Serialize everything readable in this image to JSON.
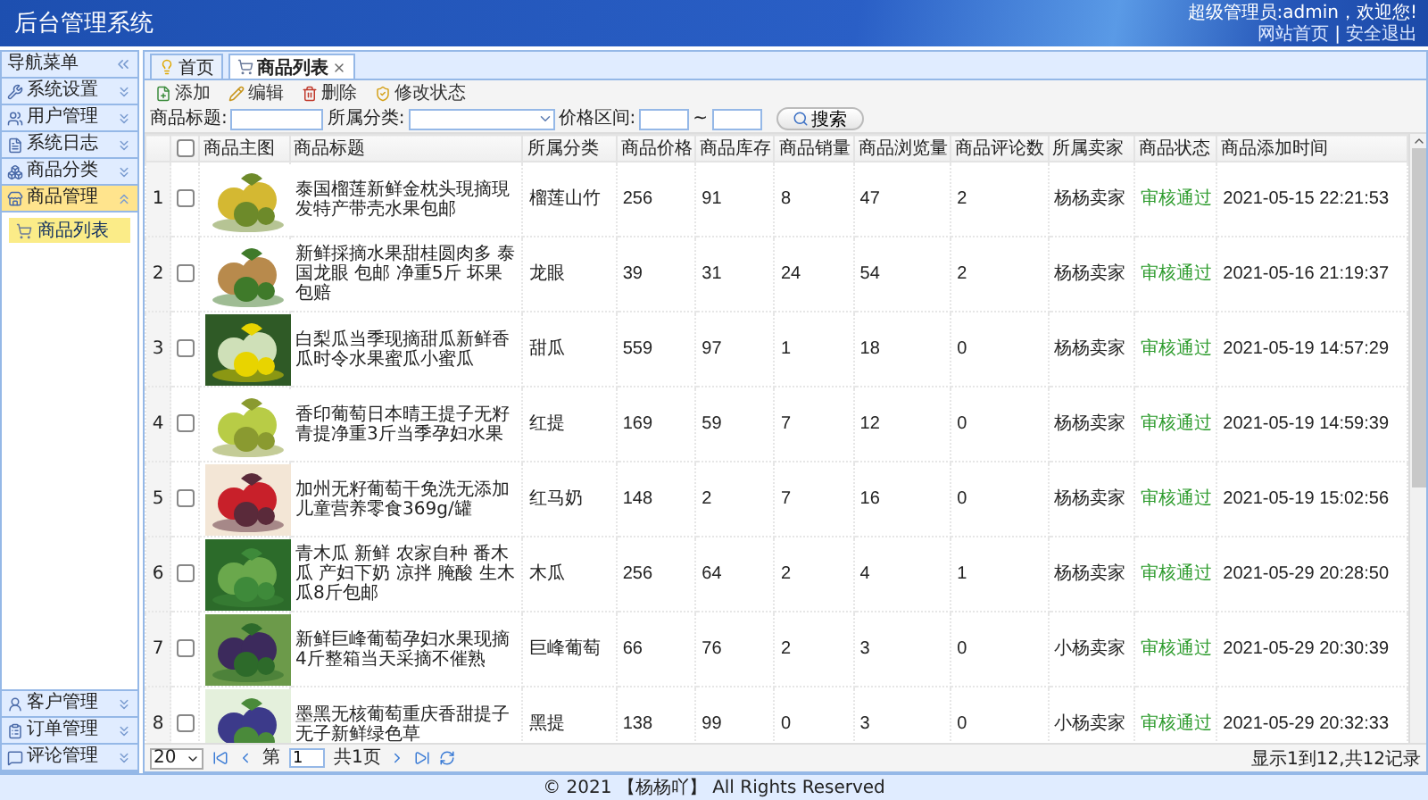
{
  "header": {
    "title": "后台管理系统",
    "welcome": "超级管理员:admin，欢迎您!",
    "links": [
      "网站首页",
      "安全退出"
    ],
    "separator": "|"
  },
  "sidebar": {
    "title": "导航菜单",
    "sections": [
      {
        "label": "系统设置",
        "expanded": false,
        "selected": false
      },
      {
        "label": "用户管理",
        "expanded": false,
        "selected": false
      },
      {
        "label": "系统日志",
        "expanded": false,
        "selected": false
      },
      {
        "label": "商品分类",
        "expanded": false,
        "selected": false
      },
      {
        "label": "商品管理",
        "expanded": true,
        "selected": true,
        "items": [
          {
            "label": "商品列表",
            "selected": true
          }
        ]
      },
      {
        "label": "客户管理",
        "expanded": false,
        "selected": false
      },
      {
        "label": "订单管理",
        "expanded": false,
        "selected": false
      },
      {
        "label": "评论管理",
        "expanded": false,
        "selected": false
      }
    ]
  },
  "tabs": [
    {
      "label": "首页",
      "selected": false,
      "closable": false
    },
    {
      "label": "商品列表",
      "selected": true,
      "closable": true
    }
  ],
  "toolbar": [
    "添加",
    "编辑",
    "删除",
    "修改状态"
  ],
  "search": {
    "fields": [
      {
        "label": "商品标题:",
        "kind": "text"
      },
      {
        "label": "所属分类:",
        "kind": "select"
      },
      {
        "label": "价格区间:",
        "kind": "range",
        "separator": "~"
      }
    ],
    "button": "搜索"
  },
  "table": {
    "select_all": false,
    "columns": [
      "商品主图",
      "商品标题",
      "所属分类",
      "商品价格",
      "商品库存",
      "商品销量",
      "商品浏览量",
      "商品评论数",
      "所属卖家",
      "商品状态",
      "商品添加时间"
    ],
    "rows": [
      {
        "no": "1",
        "checked": false,
        "title": "泰国榴莲新鲜金枕头現摘現发特产带壳水果包邮",
        "category": "榴莲山竹",
        "price": "256",
        "stock": "91",
        "sales": "8",
        "views": "47",
        "comments": "2",
        "seller": "杨杨卖家",
        "status": "审核通过",
        "added": "2021-05-15 22:21:53"
      },
      {
        "no": "2",
        "checked": false,
        "title": "新鲜採摘水果甜桂圆肉多 泰国龙眼 包邮 净重5斤 坏果包赔",
        "category": "龙眼",
        "price": "39",
        "stock": "31",
        "sales": "24",
        "views": "54",
        "comments": "2",
        "seller": "杨杨卖家",
        "status": "审核通过",
        "added": "2021-05-16 21:19:37"
      },
      {
        "no": "3",
        "checked": false,
        "title": "白梨瓜当季现摘甜瓜新鲜香瓜时令水果蜜瓜小蜜瓜",
        "category": "甜瓜",
        "price": "559",
        "stock": "97",
        "sales": "1",
        "views": "18",
        "comments": "0",
        "seller": "杨杨卖家",
        "status": "审核通过",
        "added": "2021-05-19 14:57:29"
      },
      {
        "no": "4",
        "checked": false,
        "title": "香印葡萄日本晴王提子无籽青提净重3斤当季孕妇水果",
        "category": "红提",
        "price": "169",
        "stock": "59",
        "sales": "7",
        "views": "12",
        "comments": "0",
        "seller": "杨杨卖家",
        "status": "审核通过",
        "added": "2021-05-19 14:59:39"
      },
      {
        "no": "5",
        "checked": false,
        "title": "加州无籽葡萄干免洗无添加儿童营养零食369g/罐",
        "category": "红马奶",
        "price": "148",
        "stock": "2",
        "sales": "7",
        "views": "16",
        "comments": "0",
        "seller": "杨杨卖家",
        "status": "审核通过",
        "added": "2021-05-19 15:02:56"
      },
      {
        "no": "6",
        "checked": false,
        "title": "青木瓜 新鲜 农家自种 番木瓜 产妇下奶 凉拌 腌酸 生木瓜8斤包邮",
        "category": "木瓜",
        "price": "256",
        "stock": "64",
        "sales": "2",
        "views": "4",
        "comments": "1",
        "seller": "杨杨卖家",
        "status": "审核通过",
        "added": "2021-05-29 20:28:50"
      },
      {
        "no": "7",
        "checked": false,
        "title": "新鲜巨峰葡萄孕妇水果现摘4斤整箱当天采摘不催熟",
        "category": "巨峰葡萄",
        "price": "66",
        "stock": "76",
        "sales": "2",
        "views": "3",
        "comments": "0",
        "seller": "小杨卖家",
        "status": "审核通过",
        "added": "2021-05-29 20:30:39"
      },
      {
        "no": "8",
        "checked": false,
        "title": "墨黑无核葡萄重庆香甜提子无子新鲜绿色草",
        "category": "黑提",
        "price": "138",
        "stock": "99",
        "sales": "0",
        "views": "3",
        "comments": "0",
        "seller": "小杨卖家",
        "status": "审核通过",
        "added": "2021-05-29 20:32:33"
      }
    ]
  },
  "pager": {
    "page_size": "20",
    "page_label": "第",
    "page": "1",
    "total_label": "共1页",
    "info": "显示1到12,共12记录"
  },
  "footer": "© 2021 【杨杨吖】 All Rights Reserved"
}
